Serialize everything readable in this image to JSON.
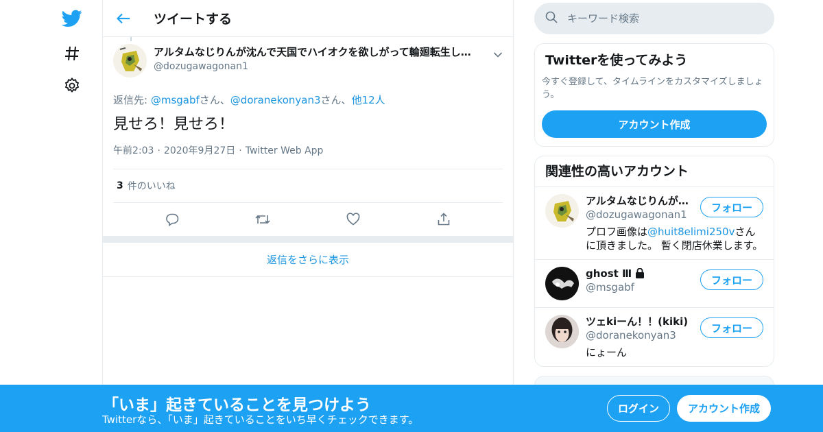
{
  "colors": {
    "accent": "#1da1f2",
    "link": "#1b95e0",
    "muted": "#657786",
    "border": "#e6ecf0"
  },
  "header": {
    "title": "ツイートする"
  },
  "tweet": {
    "author_name": "アルタムなじりんが沈んで天国でハイオクを欲しがって輪廻転生し…",
    "author_handle": "@dozugawagonan1",
    "replying_prefix": "返信先: ",
    "reply_to": [
      "@msgabf",
      "@doranekonyan3"
    ],
    "reply_suffix_1": "さん、",
    "reply_suffix_2": "さん、",
    "reply_others": "他12人",
    "text": "見せろ！見せろ！",
    "time": "午前2:03",
    "date": "2020年9月27日",
    "source": "Twitter Web App",
    "like_count": "3",
    "like_label": "件のいいね"
  },
  "more_replies": "返信をさらに表示",
  "search": {
    "placeholder": "キーワード検索"
  },
  "signup_card": {
    "title": "Twitterを使ってみよう",
    "desc": "今すぐ登録して、タイムラインをカスタマイズしましょう。",
    "button": "アカウント作成"
  },
  "related": {
    "title": "関連性の高いアカウント",
    "accounts": [
      {
        "name": "アルタムなじりんが…",
        "handle": "@dozugawagonan1",
        "bio_pre": "プロフ画像は",
        "bio_link": "@huit8elimi250v",
        "bio_post": "さんに頂きました。 暫く閉店休業します。",
        "follow": "フォロー"
      },
      {
        "name": "ghost Ⅲ",
        "handle": "@msgabf",
        "follow": "フォロー"
      },
      {
        "name": "ツェkiーん！！(kiki)",
        "handle": "@doranekonyan3",
        "bio_pre": "にょーん",
        "follow": "フォロー"
      }
    ]
  },
  "bottom_bar": {
    "title": "「いま」起きていることを見つけよう",
    "subtitle": "Twitterなら、「いま」起きていることをいち早くチェックできます。",
    "login": "ログイン",
    "signup": "アカウント作成"
  }
}
